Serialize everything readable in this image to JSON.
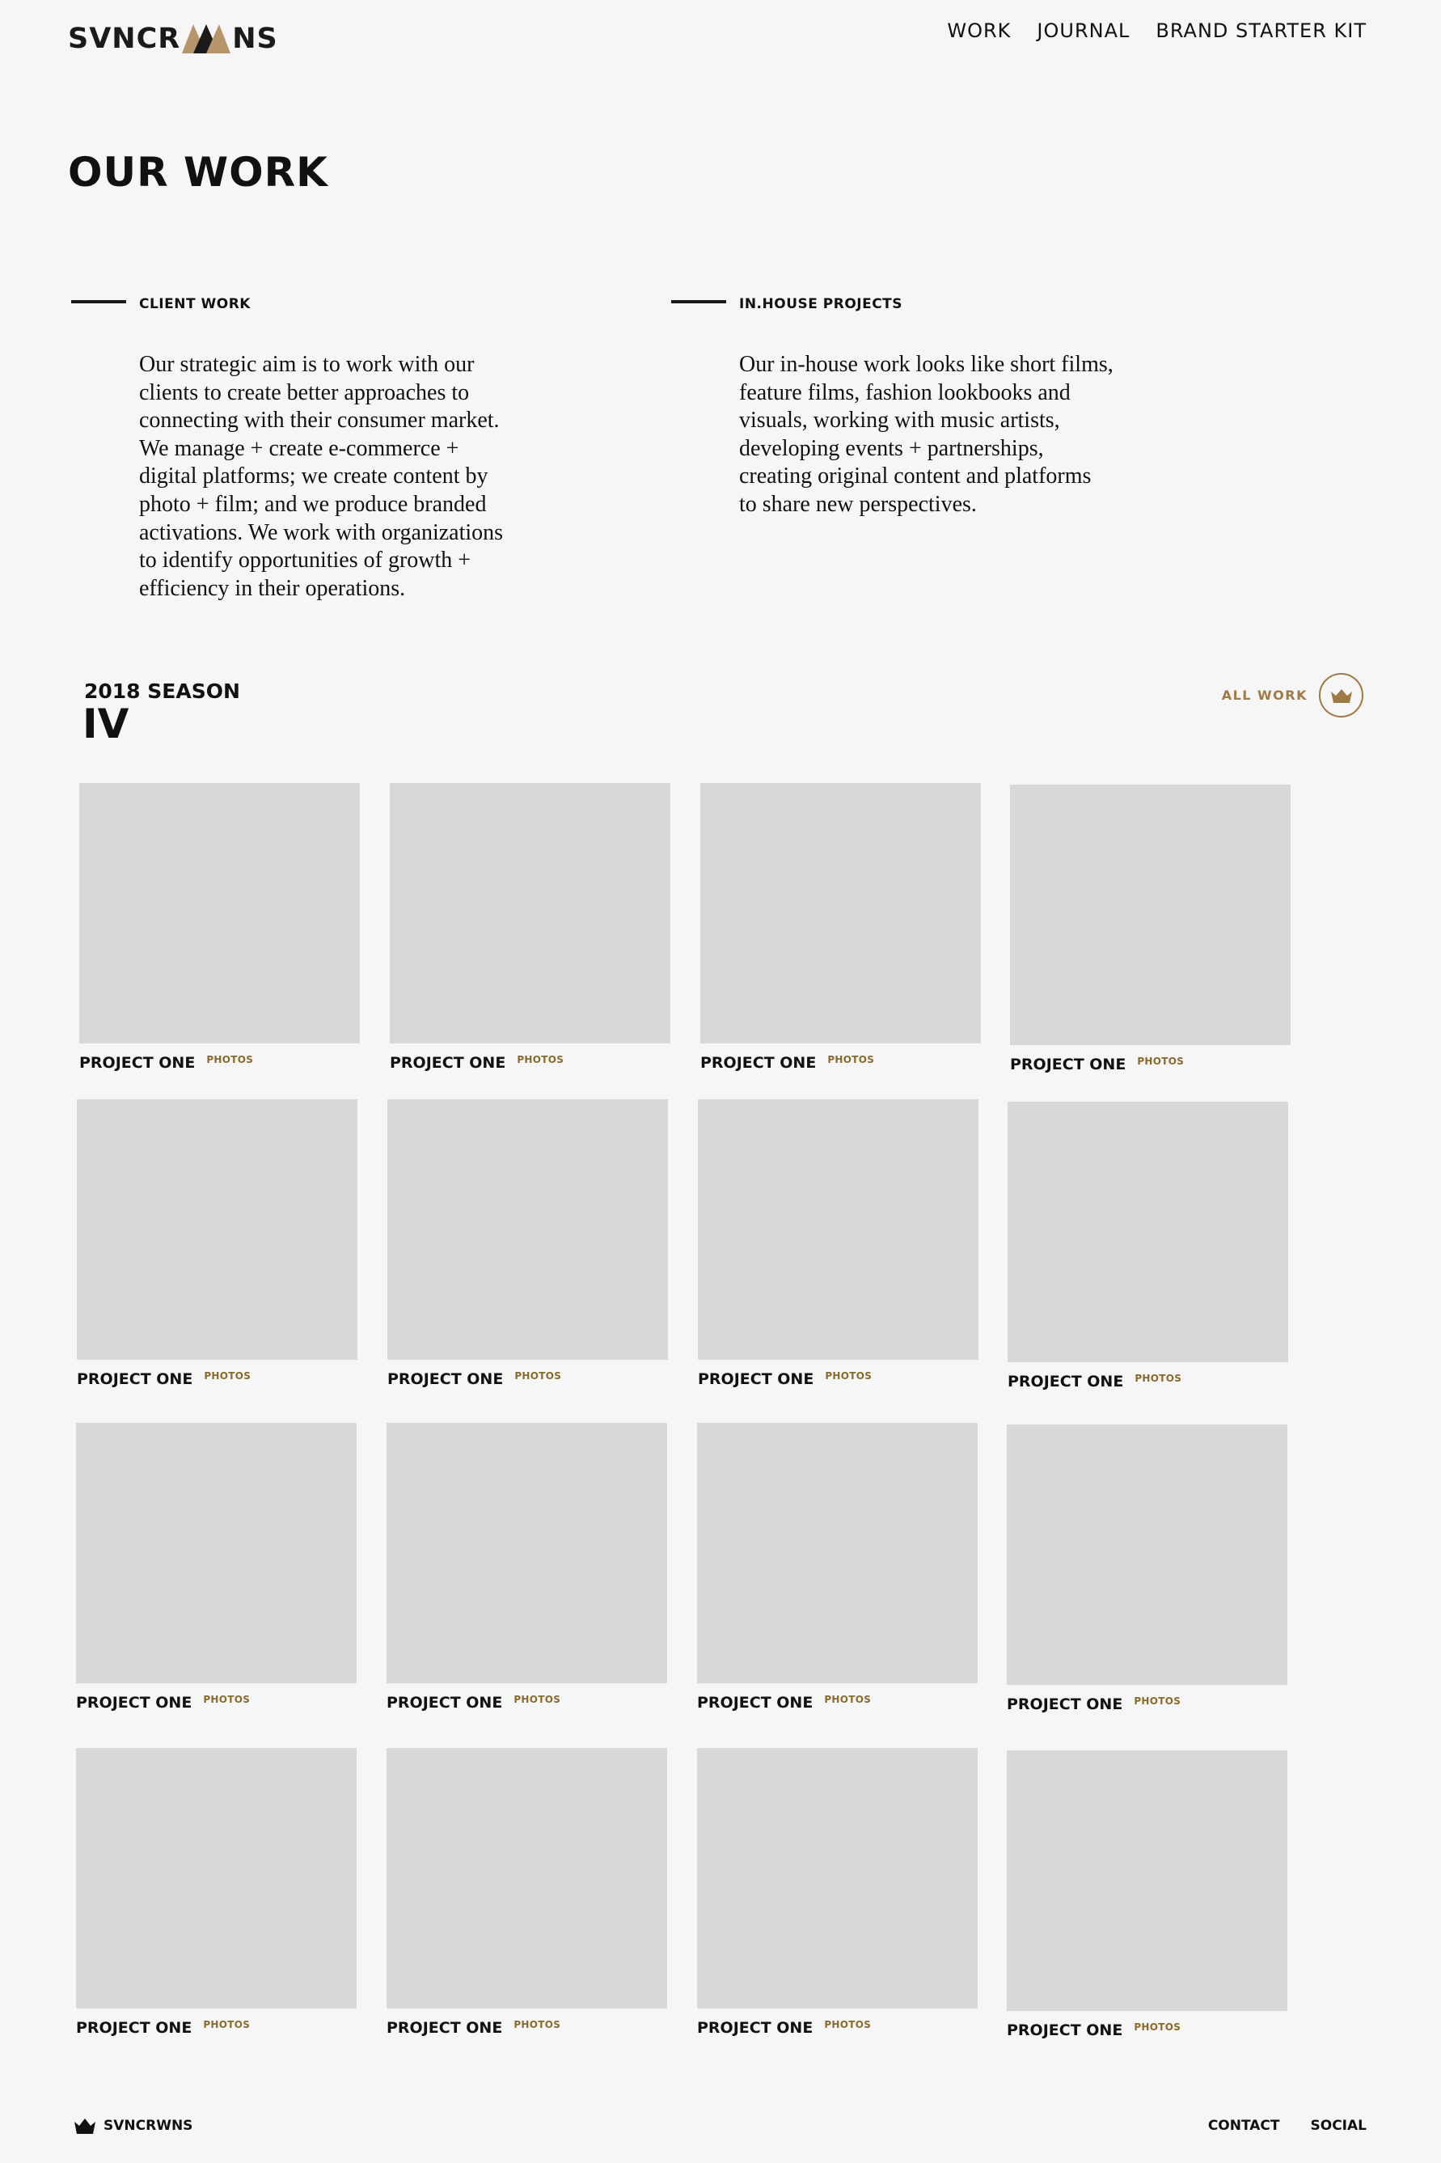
{
  "brand": {
    "logo_left": "SVNCR",
    "logo_right": "NS",
    "accent_color": "#a07a45",
    "crown_icon": "crown-icon"
  },
  "nav": {
    "items": [
      "WORK",
      "JOURNAL",
      "BRAND STARTER KIT"
    ]
  },
  "page_title": "OUR WORK",
  "sections": [
    {
      "label": "CLIENT WORK",
      "text": "Our strategic aim is to work with our\nclients to create better approaches to\nconnecting with their consumer market.\nWe manage + create e-commerce +\ndigital platforms; we create content by\nphoto + film; and we produce branded\nactivations.  We work with organizations\nto identify opportunities of growth +\nefficiency in their operations."
    },
    {
      "label": "IN.HOUSE PROJECTS",
      "text": "Our in-house work looks like short films,\nfeature films, fashion lookbooks and\nvisuals, working with music artists,\ndeveloping events + partnerships,\ncreating original content and platforms\nto share new perspectives."
    }
  ],
  "season": {
    "label": "2018 SEASON",
    "number": "IV",
    "all_work_label": "ALL WORK"
  },
  "projects": [
    {
      "title": "PROJECT ONE",
      "tag": "PHOTOS"
    },
    {
      "title": "PROJECT ONE",
      "tag": "PHOTOS"
    },
    {
      "title": "PROJECT ONE",
      "tag": "PHOTOS"
    },
    {
      "title": "PROJECT ONE",
      "tag": "PHOTOS"
    },
    {
      "title": "PROJECT ONE",
      "tag": "PHOTOS"
    },
    {
      "title": "PROJECT ONE",
      "tag": "PHOTOS"
    },
    {
      "title": "PROJECT ONE",
      "tag": "PHOTOS"
    },
    {
      "title": "PROJECT ONE",
      "tag": "PHOTOS"
    },
    {
      "title": "PROJECT ONE",
      "tag": "PHOTOS"
    },
    {
      "title": "PROJECT ONE",
      "tag": "PHOTOS"
    },
    {
      "title": "PROJECT ONE",
      "tag": "PHOTOS"
    },
    {
      "title": "PROJECT ONE",
      "tag": "PHOTOS"
    },
    {
      "title": "PROJECT ONE",
      "tag": "PHOTOS"
    },
    {
      "title": "PROJECT ONE",
      "tag": "PHOTOS"
    },
    {
      "title": "PROJECT ONE",
      "tag": "PHOTOS"
    },
    {
      "title": "PROJECT ONE",
      "tag": "PHOTOS"
    }
  ],
  "footer": {
    "logo_text": "SVNCRWNS",
    "links": [
      "CONTACT",
      "SOCIAL"
    ]
  }
}
